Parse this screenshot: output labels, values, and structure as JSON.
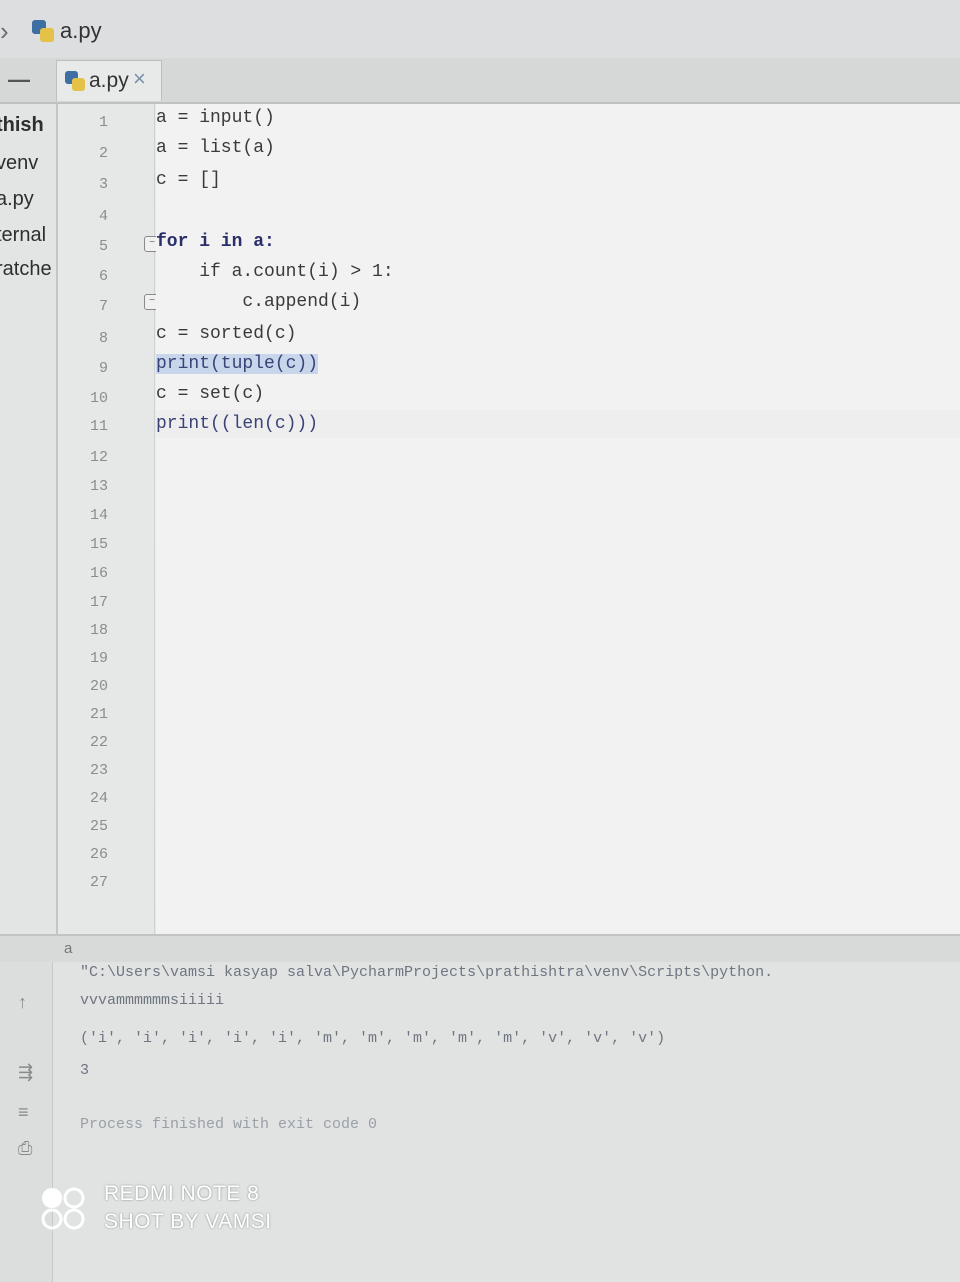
{
  "breadcrumb": {
    "arrow": "›",
    "file_label": "a.py"
  },
  "tabs": [
    {
      "label": "a.py",
      "close": "×"
    }
  ],
  "project_tree": [
    {
      "label": "thish",
      "bold": true
    },
    {
      "label": "venv",
      "bold": false
    },
    {
      "label": "a.py",
      "bold": false
    },
    {
      "label": "ternal",
      "bold": false
    },
    {
      "label": "ratche",
      "bold": false
    }
  ],
  "line_numbers": [
    "1",
    "2",
    "3",
    "4",
    "5",
    "6",
    "7",
    "8",
    "9",
    "10",
    "11",
    "12",
    "13",
    "14",
    "15",
    "16",
    "17",
    "18",
    "19",
    "20",
    "21",
    "22",
    "23",
    "24",
    "25",
    "26",
    "27"
  ],
  "code_lines": [
    {
      "n": "1",
      "text": "a = input()"
    },
    {
      "n": "2",
      "text": "a = list(a)"
    },
    {
      "n": "3",
      "text": "c = []"
    },
    {
      "n": "4",
      "text": ""
    },
    {
      "n": "5",
      "text": "for i in a:"
    },
    {
      "n": "6",
      "text": "    if a.count(i) > 1:"
    },
    {
      "n": "7",
      "text": "        c.append(i)"
    },
    {
      "n": "8",
      "text": "c = sorted(c)"
    },
    {
      "n": "9",
      "text": "print(tuple(c))"
    },
    {
      "n": "10",
      "text": "c = set(c)"
    },
    {
      "n": "11",
      "text": "print((len(c)))"
    }
  ],
  "run_panel": {
    "tab_label": "a",
    "command": "\"C:\\Users\\vamsi kasyap salva\\PycharmProjects\\prathishtra\\venv\\Scripts\\python.",
    "input_echo": "vvvammmmmmsiiiii",
    "tuple_output": "('i', 'i', 'i', 'i', 'i', 'm', 'm', 'm', 'm', 'm', 'v', 'v', 'v')",
    "count_output": "3",
    "finished": "Process finished with exit code 0"
  },
  "watermark": {
    "line1": "REDMI NOTE 8",
    "line2": "SHOT BY VAMSI"
  },
  "colors": {
    "keyword": "#2a2f6a",
    "number": "#3b5fb0",
    "selection": "#c8d6ec",
    "background": "#f1f2f1"
  }
}
